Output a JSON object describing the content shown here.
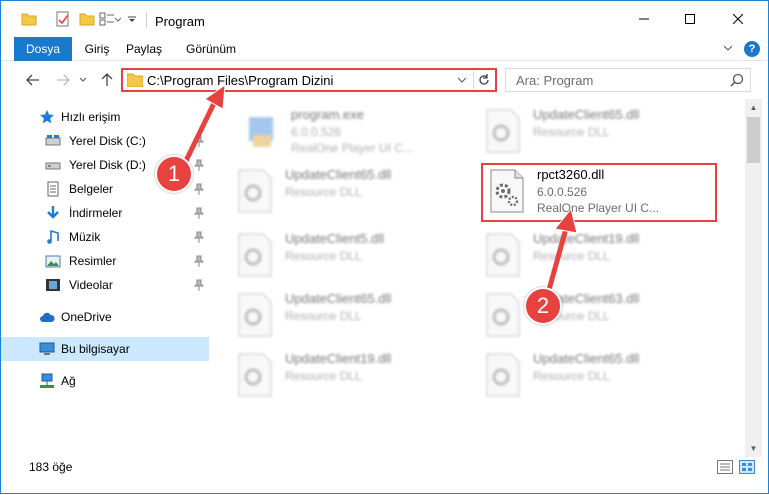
{
  "window": {
    "title": "Program",
    "controls": {
      "minimize": "—",
      "maximize": "☐",
      "close": "✕"
    }
  },
  "ribbon": {
    "tabs": [
      "Dosya",
      "Giriş",
      "Paylaş",
      "Görünüm"
    ],
    "help": "?"
  },
  "navigation": {
    "address": "C:\\Program Files\\Program Dizini",
    "search_placeholder": "Ara: Program"
  },
  "sidebar": {
    "items": [
      {
        "label": "Hızlı erişim",
        "icon": "star-icon",
        "pinned": false
      },
      {
        "label": "Yerel Disk (C:)",
        "icon": "drive-icon",
        "pinned": true
      },
      {
        "label": "Yerel Disk (D:)",
        "icon": "drive-icon",
        "pinned": true
      },
      {
        "label": "Belgeler",
        "icon": "documents-icon",
        "pinned": true
      },
      {
        "label": "İndirmeler",
        "icon": "download-icon",
        "pinned": true
      },
      {
        "label": "Müzik",
        "icon": "music-icon",
        "pinned": true
      },
      {
        "label": "Resimler",
        "icon": "pictures-icon",
        "pinned": true
      },
      {
        "label": "Videolar",
        "icon": "videos-icon",
        "pinned": true
      },
      {
        "label": "OneDrive",
        "icon": "cloud-icon",
        "pinned": false
      },
      {
        "label": "Bu bilgisayar",
        "icon": "computer-icon",
        "pinned": false
      },
      {
        "label": "Ağ",
        "icon": "network-icon",
        "pinned": false
      }
    ]
  },
  "files": [
    {
      "name": "program.exe",
      "line2": "6.0.0.526",
      "line3": "RealOne Player UI C...",
      "blurred": true
    },
    {
      "name": "UpdateClient65.dll",
      "line2": "Resource DLL",
      "line3": "",
      "blurred": true
    },
    {
      "name": "UpdateClient65.dll",
      "line2": "Resource DLL",
      "line3": "",
      "blurred": true
    },
    {
      "name": "rpct3260.dll",
      "line2": "6.0.0.526",
      "line3": "RealOne Player UI C...",
      "blurred": false
    },
    {
      "name": "UpdateClient5.dll",
      "line2": "Resource DLL",
      "line3": "",
      "blurred": true
    },
    {
      "name": "UpdateClient19.dll",
      "line2": "Resource DLL",
      "line3": "",
      "blurred": true
    },
    {
      "name": "UpdateClient65.dll",
      "line2": "Resource DLL",
      "line3": "",
      "blurred": true
    },
    {
      "name": "UpdateClient63.dll",
      "line2": "Resource DLL",
      "line3": "",
      "blurred": true
    },
    {
      "name": "UpdateClient19.dll",
      "line2": "Resource DLL",
      "line3": "",
      "blurred": true
    },
    {
      "name": "UpdateClient65.dll",
      "line2": "Resource DLL",
      "line3": "",
      "blurred": true
    }
  ],
  "status": {
    "item_count": "183 öğe"
  },
  "annotations": {
    "step1": "1",
    "step2": "2",
    "color": "#e8423f"
  }
}
